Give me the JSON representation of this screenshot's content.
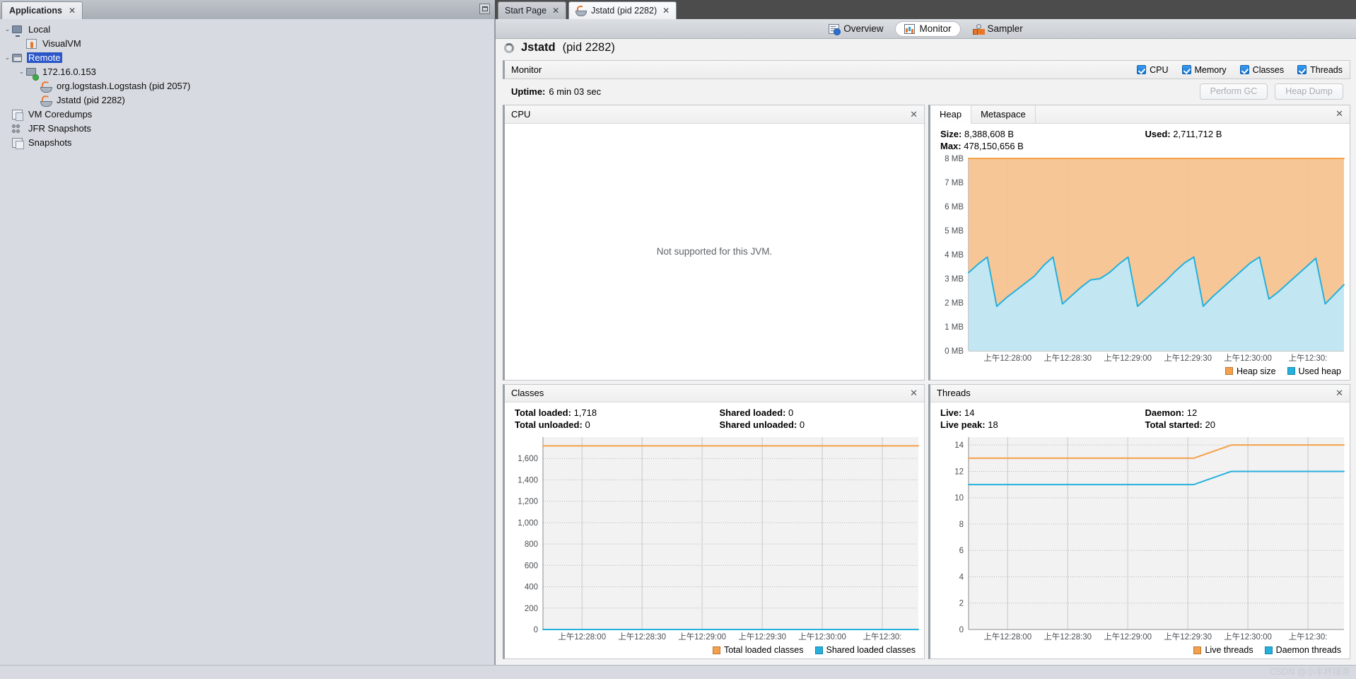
{
  "window": {
    "buttons": [
      "◀",
      "▶",
      "▼",
      "▣"
    ]
  },
  "applications_panel": {
    "tab_label": "Applications",
    "tab_close": "✕",
    "minimize_icon": "minimize-icon",
    "tree": [
      {
        "label": "Local",
        "depth": 0,
        "twisty": "⌄",
        "icon": "monitor-icon",
        "selected": false
      },
      {
        "label": "VisualVM",
        "depth": 1,
        "twisty": "",
        "icon": "visualvm-icon",
        "selected": false
      },
      {
        "label": "Remote",
        "depth": 0,
        "twisty": "⌄",
        "icon": "remote-host-icon",
        "selected": true
      },
      {
        "label": "172.16.0.153",
        "depth": 1,
        "twisty": "⌄",
        "icon": "host-icon",
        "selected": false
      },
      {
        "label": "org.logstash.Logstash (pid 2057)",
        "depth": 2,
        "twisty": "",
        "icon": "java-app-icon",
        "selected": false
      },
      {
        "label": "Jstatd (pid 2282)",
        "depth": 2,
        "twisty": "",
        "icon": "java-app-icon",
        "selected": false
      },
      {
        "label": "VM Coredumps",
        "depth": 0,
        "twisty": "",
        "icon": "coredump-icon",
        "selected": false
      },
      {
        "label": "JFR Snapshots",
        "depth": 0,
        "twisty": "",
        "icon": "jfr-snapshot-icon",
        "selected": false
      },
      {
        "label": "Snapshots",
        "depth": 0,
        "twisty": "",
        "icon": "snapshot-icon",
        "selected": false
      }
    ]
  },
  "document_tabs": [
    {
      "label": "Start Page",
      "icon": "",
      "close": "✕",
      "active": false
    },
    {
      "label": "Jstatd (pid 2282)",
      "icon": "java-app-icon",
      "close": "✕",
      "active": true
    }
  ],
  "view_toolbar": [
    {
      "label": "Overview",
      "icon": "overview-icon",
      "active": false
    },
    {
      "label": "Monitor",
      "icon": "monitor-icon",
      "active": true
    },
    {
      "label": "Sampler",
      "icon": "sampler-icon",
      "active": false
    }
  ],
  "app_header": {
    "name": "Jstatd",
    "pid_text": "(pid 2282)",
    "spinner": "loading-spinner"
  },
  "monitor": {
    "title": "Monitor",
    "checkboxes": [
      {
        "label": "CPU",
        "checked": true
      },
      {
        "label": "Memory",
        "checked": true
      },
      {
        "label": "Classes",
        "checked": true
      },
      {
        "label": "Threads",
        "checked": true
      }
    ],
    "uptime_label": "Uptime:",
    "uptime_value": "6 min 03 sec",
    "perform_gc_label": "Perform GC",
    "heap_dump_label": "Heap Dump"
  },
  "panels": {
    "cpu": {
      "title": "CPU",
      "close": "✕",
      "message": "Not supported for this JVM."
    },
    "memory": {
      "tabs": [
        {
          "label": "Heap",
          "active": true
        },
        {
          "label": "Metaspace",
          "active": false
        }
      ],
      "close": "✕",
      "stats": [
        {
          "label": "Size:",
          "value": "8,388,608 B"
        },
        {
          "label": "Used:",
          "value": "2,711,712 B"
        },
        {
          "label": "Max:",
          "value": "478,150,656 B"
        },
        {
          "label": "",
          "value": ""
        }
      ]
    },
    "classes": {
      "title": "Classes",
      "close": "✕",
      "stats": [
        {
          "label": "Total loaded:",
          "value": "1,718"
        },
        {
          "label": "Shared loaded:",
          "value": "0"
        },
        {
          "label": "Total unloaded:",
          "value": "0"
        },
        {
          "label": "Shared unloaded:",
          "value": "0"
        }
      ]
    },
    "threads": {
      "title": "Threads",
      "close": "✕",
      "stats": [
        {
          "label": "Live:",
          "value": "14"
        },
        {
          "label": "Daemon:",
          "value": "12"
        },
        {
          "label": "Live peak:",
          "value": "18"
        },
        {
          "label": "Total started:",
          "value": "20"
        }
      ]
    }
  },
  "colors": {
    "orange": "#F5A04A",
    "orange_line": "#F0921E",
    "orange_fill": "#F7C390",
    "blue": "#25B0DD",
    "blue_fill": "#BFE9F7",
    "chart_bg": "#F2F2F2",
    "grid": "#C9C9C9",
    "selection": "#2B56C7"
  },
  "chart_data": [
    {
      "id": "heap-chart",
      "type": "area",
      "title": "Heap",
      "xlabel": "",
      "ylabel": "",
      "ylim": [
        0,
        8
      ],
      "ytick_labels": [
        "0 MB",
        "1 MB",
        "2 MB",
        "3 MB",
        "4 MB",
        "5 MB",
        "6 MB",
        "7 MB",
        "8 MB"
      ],
      "ytick_values": [
        0,
        1,
        2,
        3,
        4,
        5,
        6,
        7,
        8
      ],
      "xtick_labels": [
        "上午12:28:00",
        "上午12:28:30",
        "上午12:29:00",
        "上午12:29:30",
        "上午12:30:00",
        "上午12:30:"
      ],
      "grid": true,
      "legend": [
        {
          "name": "Heap size",
          "color": "#F5A04A"
        },
        {
          "name": "Used heap",
          "color": "#25B0DD"
        }
      ],
      "series": [
        {
          "name": "Heap size",
          "color": "#F5A04A",
          "values": [
            8,
            8,
            8,
            8,
            8,
            8,
            8,
            8,
            8,
            8,
            8,
            8,
            8,
            8,
            8,
            8,
            8,
            8,
            8,
            8,
            8,
            8,
            8,
            8,
            8,
            8,
            8,
            8,
            8,
            8,
            8,
            8,
            8,
            8,
            8,
            8,
            8,
            8,
            8,
            8,
            8
          ]
        },
        {
          "name": "Used heap",
          "color": "#25B0DD",
          "values": [
            3.25,
            3.6,
            3.9,
            1.85,
            2.2,
            2.5,
            2.8,
            3.1,
            3.55,
            3.9,
            1.95,
            2.3,
            2.65,
            2.95,
            3.0,
            3.25,
            3.6,
            3.9,
            1.85,
            2.2,
            2.55,
            2.9,
            3.3,
            3.65,
            3.9,
            1.85,
            2.25,
            2.6,
            2.95,
            3.3,
            3.65,
            3.9,
            2.15,
            2.45,
            2.8,
            3.15,
            3.5,
            3.85,
            1.95,
            2.35,
            2.75
          ]
        }
      ]
    },
    {
      "id": "classes-chart",
      "type": "line",
      "title": "Classes",
      "xlabel": "",
      "ylabel": "",
      "ylim": [
        0,
        1800
      ],
      "ytick_labels": [
        "0",
        "200",
        "400",
        "600",
        "800",
        "1,000",
        "1,200",
        "1,400",
        "1,600"
      ],
      "ytick_values": [
        0,
        200,
        400,
        600,
        800,
        1000,
        1200,
        1400,
        1600
      ],
      "xtick_labels": [
        "上午12:28:00",
        "上午12:28:30",
        "上午12:29:00",
        "上午12:29:30",
        "上午12:30:00",
        "上午12:30:"
      ],
      "grid": true,
      "legend": [
        {
          "name": "Total loaded classes",
          "color": "#F5A04A"
        },
        {
          "name": "Shared loaded classes",
          "color": "#25B0DD"
        }
      ],
      "series": [
        {
          "name": "Total loaded classes",
          "color": "#F5A04A",
          "values": [
            1718,
            1718,
            1718,
            1718,
            1718,
            1718,
            1718,
            1718,
            1718
          ]
        },
        {
          "name": "Shared loaded classes",
          "color": "#25B0DD",
          "values": [
            0,
            0,
            0,
            0,
            0,
            0,
            0,
            0,
            0
          ]
        }
      ]
    },
    {
      "id": "threads-chart",
      "type": "line",
      "title": "Threads",
      "xlabel": "",
      "ylabel": "",
      "ylim": [
        0,
        14.6
      ],
      "ytick_labels": [
        "0",
        "2",
        "4",
        "6",
        "8",
        "10",
        "12",
        "14"
      ],
      "ytick_values": [
        0,
        2,
        4,
        6,
        8,
        10,
        12,
        14
      ],
      "xtick_labels": [
        "上午12:28:00",
        "上午12:28:30",
        "上午12:29:00",
        "上午12:29:30",
        "上午12:30:00",
        "上午12:30:"
      ],
      "grid": true,
      "legend": [
        {
          "name": "Live threads",
          "color": "#F5A04A"
        },
        {
          "name": "Daemon threads",
          "color": "#25B0DD"
        }
      ],
      "series": [
        {
          "name": "Live threads",
          "color": "#F5A04A",
          "values": [
            13,
            13,
            13,
            13,
            13,
            13,
            13,
            14,
            14,
            14,
            14
          ]
        },
        {
          "name": "Daemon threads",
          "color": "#25B0DD",
          "values": [
            11,
            11,
            11,
            11,
            11,
            11,
            11,
            12,
            12,
            12,
            12
          ]
        }
      ]
    }
  ],
  "watermark": "CSDN @小半杯绿茶"
}
